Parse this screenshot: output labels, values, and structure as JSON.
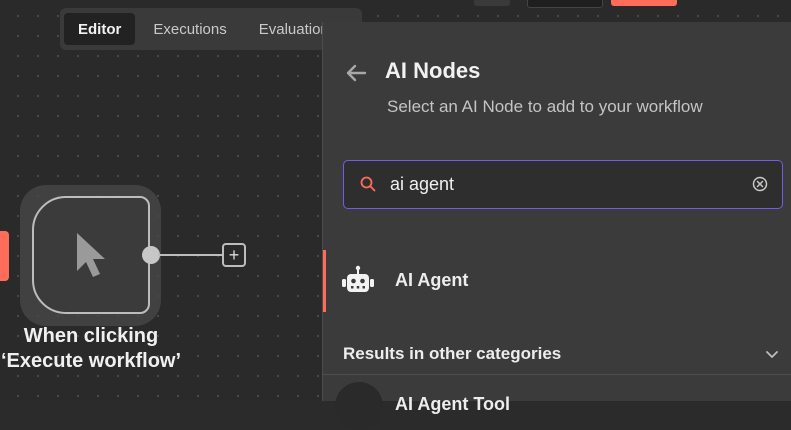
{
  "view_tabs": [
    "Editor",
    "Executions",
    "Evaluations"
  ],
  "workflow": {
    "trigger_node_label": "When clicking ‘Execute workflow’",
    "add_node_symbol": "+"
  },
  "panel": {
    "title": "AI Nodes",
    "subtitle": "Select an AI Node to add to your workflow",
    "search": {
      "value": "ai agent",
      "placeholder": ""
    },
    "results": [
      {
        "label": "AI Agent",
        "icon": "robot-icon",
        "selected": true
      }
    ],
    "other_categories": {
      "heading": "Results in other categories",
      "items": [
        {
          "label": "AI Agent Tool",
          "icon": "robot-icon"
        }
      ]
    }
  },
  "colors": {
    "accent": "#ff6d5a",
    "search_focus": "#6f5ee8",
    "panel_bg": "#3b3b3b",
    "canvas_bg": "#2a2a2a"
  }
}
